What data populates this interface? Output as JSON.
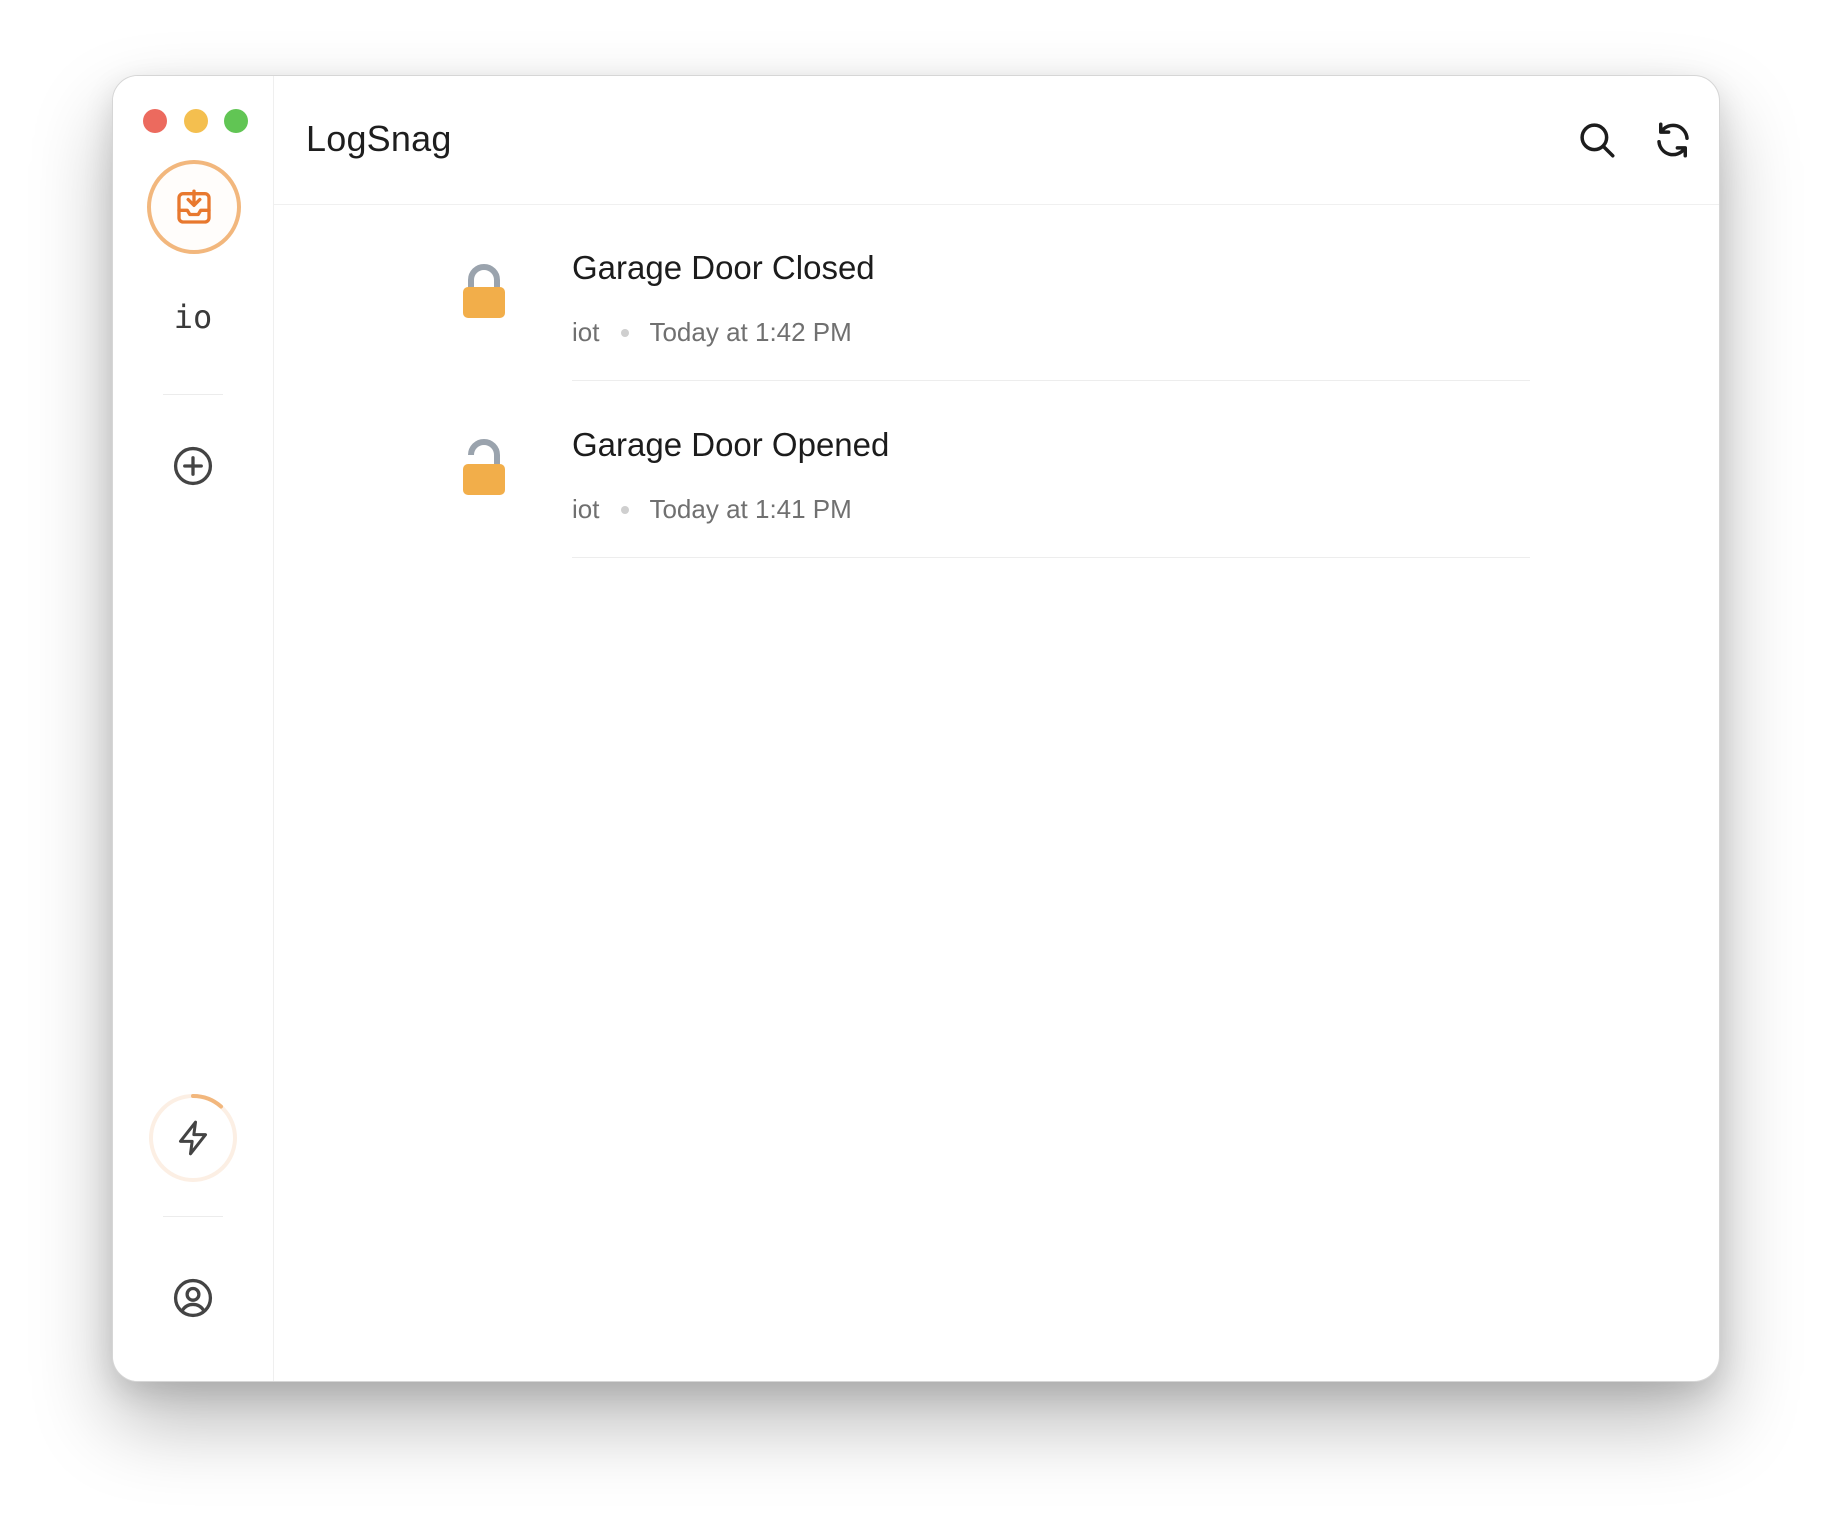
{
  "window": {
    "controls": [
      "close",
      "minimize",
      "maximize"
    ]
  },
  "sidebar": {
    "inbox_icon": "inbox-download-icon",
    "project_label": "io",
    "add_icon": "plus-circle-icon",
    "usage_icon": "lightning-icon",
    "account_icon": "user-circle-icon"
  },
  "header": {
    "title": "LogSnag",
    "search_icon": "search-icon",
    "refresh_icon": "refresh-icon"
  },
  "events": [
    {
      "icon": "lock-closed-icon",
      "title": "Garage Door Closed",
      "channel": "iot",
      "time": "Today at 1:42 PM"
    },
    {
      "icon": "lock-open-icon",
      "title": "Garage Door Opened",
      "channel": "iot",
      "time": "Today at 1:41 PM"
    }
  ],
  "colors": {
    "accent": "#ef8a3a",
    "accent_light": "#f2b77d",
    "lock_body": "#f2ae4a",
    "lock_shackle": "#9aa3ad"
  }
}
